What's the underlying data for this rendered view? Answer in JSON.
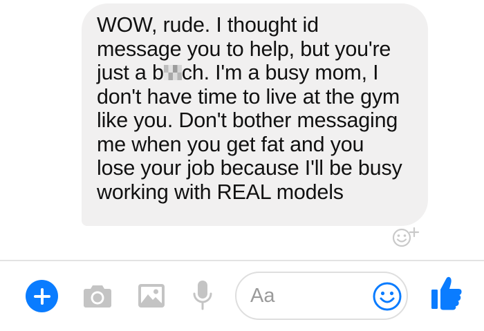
{
  "message": {
    "line1": "WOW, rude. I thought id",
    "line2": "message you to help, but you're",
    "line3_before": "just a b",
    "line3_after": "ch. I'm a busy mom, I",
    "line4": "don't have time to live at the gym",
    "line5": "like you. Don't bother messaging",
    "line6": "me when you get fat and you",
    "line7": "lose your job because I'll be busy",
    "line8": "working with REAL models"
  },
  "composer": {
    "placeholder": "Aa"
  },
  "icons": {
    "react": "smiley-plus-icon",
    "add": "plus-icon",
    "camera": "camera-icon",
    "image": "image-icon",
    "mic": "microphone-icon",
    "emoji": "smiley-icon",
    "like": "thumbs-up-icon"
  },
  "colors": {
    "accent": "#0a7cff",
    "bubble": "#f1f0f0",
    "tool_gray": "#c4c4c4"
  }
}
